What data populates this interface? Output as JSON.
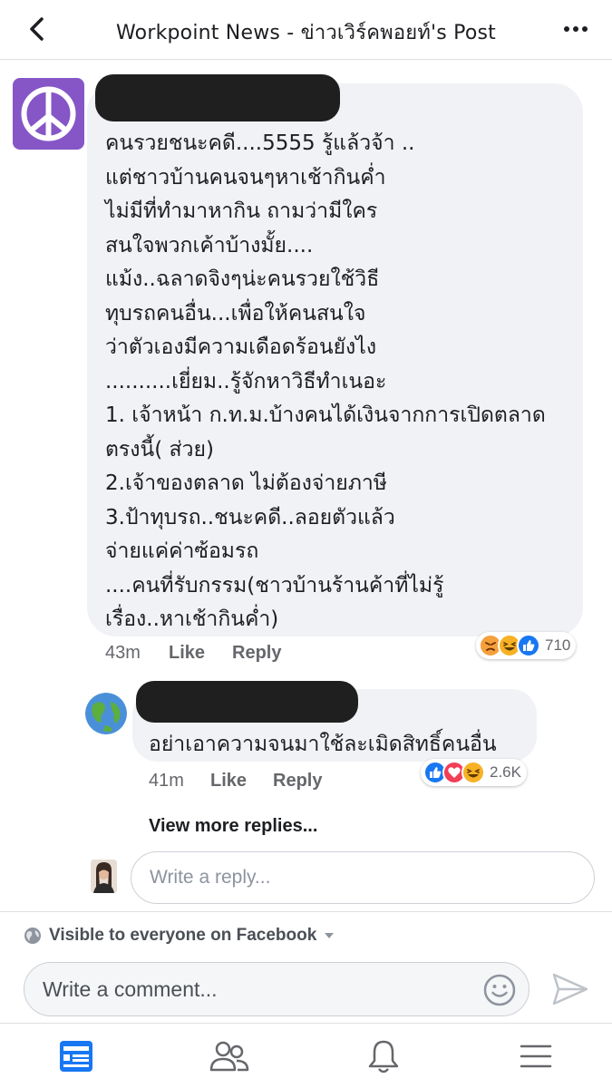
{
  "header": {
    "title": "Workpoint News - ข่าวเวิร์คพอยท์'s Post"
  },
  "comment": {
    "text": "คนรวยชนะคดี....5555  รู้แล้วจ้า  ..\nแต่ชาวบ้านคนจนๆหาเช้ากินค่ำ\nไม่มีที่ทำมาหากิน  ถามว่ามีใคร\nสนใจพวกเค้าบ้างมั้ย....\nแม้ง..ฉลาดจิงๆน่ะคนรวยใช้วิธี\nทุบรถคนอื่น...เพื่อให้คนสนใจ\nว่าตัวเองมีความเดือดร้อนยังไง\n..........เยี่ยม..รู้จักหาวิธีทำเนอะ\n1. เจ้าหน้า ก.ท.ม.บ้างคนได้เงินจากการเปิดตลาด\nตรงนี้( ส่วย)\n2.เจ้าของตลาด ไม่ต้องจ่ายภาษี\n3.ป้าทุบรถ..ชนะคดี..ลอยตัวแล้ว\nจ่ายแค่ค่าซ้อมรถ\n....คนที่รับกรรม(ชาวบ้านร้านค้าที่ไม่รู้\nเรื่อง..หาเช้ากินค่ำ)",
    "time": "43m",
    "like_label": "Like",
    "reply_label": "Reply",
    "reaction_count": "710",
    "reactions": [
      "angry-icon",
      "haha-icon",
      "like-icon"
    ]
  },
  "reply": {
    "text": "อย่าเอาความจนมาใช้ละเมิดสิทธิ์คนอื่น",
    "time": "41m",
    "like_label": "Like",
    "reply_label": "Reply",
    "reaction_count": "2.6K",
    "reactions": [
      "like-icon",
      "love-icon",
      "haha-icon"
    ]
  },
  "view_more_replies": "View more replies...",
  "reply_input": {
    "placeholder": "Write a reply..."
  },
  "visibility": {
    "text": "Visible to everyone on Facebook"
  },
  "comment_input": {
    "placeholder": "Write a comment..."
  },
  "colors": {
    "accent": "#1877f2",
    "bubble": "#f0f2f5",
    "muted_text": "#65676b",
    "angry": "#f4a03c",
    "love": "#f33e58",
    "haha": "#f7b125"
  },
  "tabbar": {
    "items": [
      "news-feed-icon",
      "friends-icon",
      "notifications-icon",
      "menu-icon"
    ]
  }
}
